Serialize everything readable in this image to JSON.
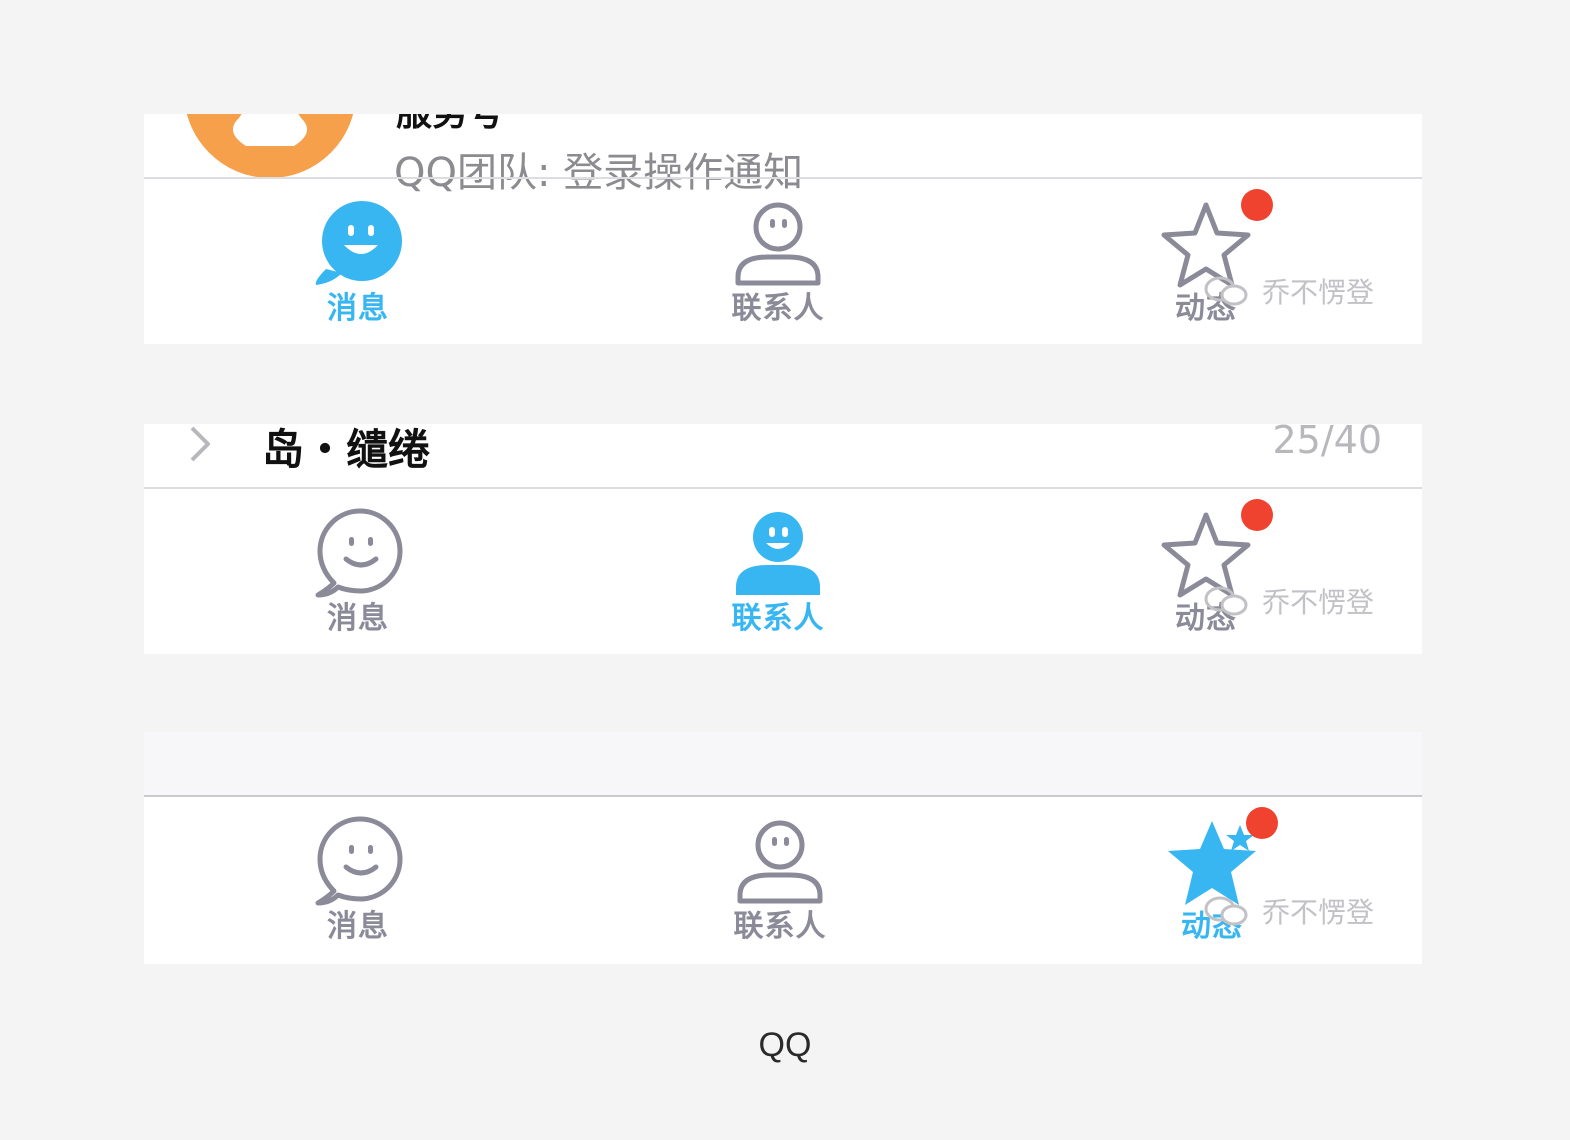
{
  "panels": [
    {
      "top_content": {
        "title_text": "服务号",
        "preview_text": "QQ团队: 登录操作通知"
      },
      "tabs": [
        {
          "label": "消息",
          "icon": "message-smile-icon",
          "active": true
        },
        {
          "label": "联系人",
          "icon": "contact-person-icon",
          "active": false
        },
        {
          "label": "动态",
          "icon": "star-icon",
          "active": false
        }
      ],
      "watermark": "乔不愣登"
    },
    {
      "top_content": {
        "group_name": "岛・缱绻",
        "count": "25/40"
      },
      "tabs": [
        {
          "label": "消息",
          "icon": "message-smile-icon",
          "active": false
        },
        {
          "label": "联系人",
          "icon": "contact-person-icon",
          "active": true
        },
        {
          "label": "动态",
          "icon": "star-icon",
          "active": false
        }
      ],
      "watermark": "乔不愣登"
    },
    {
      "tabs": [
        {
          "label": "消息",
          "icon": "message-smile-icon",
          "active": false
        },
        {
          "label": "联系人",
          "icon": "contact-person-icon",
          "active": false
        },
        {
          "label": "动态",
          "icon": "star-icon",
          "active": true
        }
      ],
      "watermark": "乔不愣登"
    }
  ],
  "caption": "QQ",
  "colors": {
    "active": "#37b6f2",
    "inactive": "#8a8a99",
    "badge": "#f0432f",
    "service_avatar": "#f7a04b"
  }
}
